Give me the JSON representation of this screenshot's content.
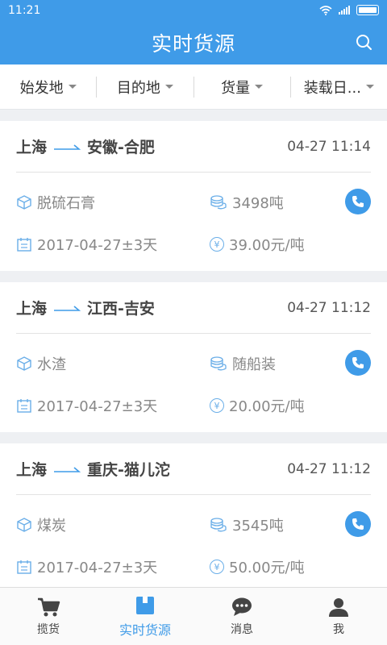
{
  "status_bar": {
    "time": "11:21"
  },
  "header": {
    "title": "实时货源"
  },
  "filters": [
    {
      "label": "始发地"
    },
    {
      "label": "目的地"
    },
    {
      "label": "货量"
    },
    {
      "label": "装载日..."
    }
  ],
  "cards": [
    {
      "origin": "上海",
      "destination": "安徽-合肥",
      "time": "04-27 11:14",
      "cargo": "脱硫石膏",
      "quantity": "3498吨",
      "date": "2017-04-27±3天",
      "price": "39.00元/吨"
    },
    {
      "origin": "上海",
      "destination": "江西-吉安",
      "time": "04-27 11:12",
      "cargo": "水渣",
      "quantity": "随船装",
      "date": "2017-04-27±3天",
      "price": "20.00元/吨"
    },
    {
      "origin": "上海",
      "destination": "重庆-猫儿沱",
      "time": "04-27 11:12",
      "cargo": "煤炭",
      "quantity": "3545吨",
      "date": "2017-04-27±3天",
      "price": "50.00元/吨"
    }
  ],
  "currency_symbol": "¥",
  "nav": [
    {
      "label": "揽货",
      "icon": "cart-icon"
    },
    {
      "label": "实时货源",
      "icon": "box-icon",
      "active": true
    },
    {
      "label": "消息",
      "icon": "chat-icon"
    },
    {
      "label": "我",
      "icon": "user-icon"
    }
  ],
  "colors": {
    "primary": "#3f9be8",
    "background": "#eef0f3"
  }
}
